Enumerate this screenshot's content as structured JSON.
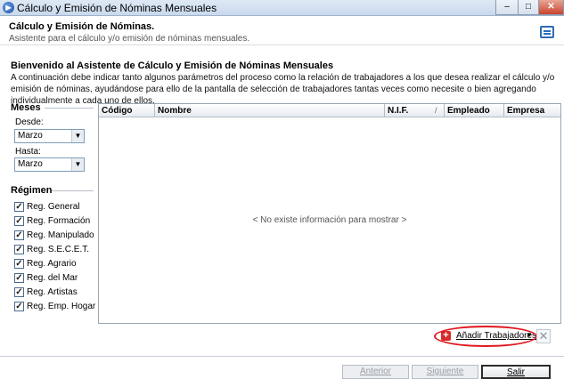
{
  "window": {
    "title": "Cálculo y Emisión de Nóminas Mensuales",
    "controls": {
      "minimize": "–",
      "maximize": "□",
      "close": "✕"
    }
  },
  "header": {
    "title": "Cálculo y Emisión de Nóminas.",
    "subtitle": "Asistente para el cálculo y/o emisión de nóminas mensuales."
  },
  "welcome": {
    "heading": "Bienvenido al Asistente de Cálculo y Emisión de Nóminas Mensuales",
    "text": "A continuación debe indicar tanto algunos parámetros del proceso como la relación de trabajadores a los que desea realizar el cálculo y/o emisión de nóminas, ayudándose para ello de la pantalla de selección de trabajadores tantas veces como necesite o bien agregando individualmente a cada uno de ellos."
  },
  "meses": {
    "label": "Meses",
    "desde": {
      "label": "Desde:",
      "value": "Marzo"
    },
    "hasta": {
      "label": "Hasta:",
      "value": "Marzo"
    }
  },
  "regimen": {
    "label": "Régimen",
    "items": [
      {
        "label": "Reg. General",
        "checked": true
      },
      {
        "label": "Reg. Formación",
        "checked": true
      },
      {
        "label": "Reg. Manipulado",
        "checked": true
      },
      {
        "label": "Reg. S.E.C.E.T.",
        "checked": true
      },
      {
        "label": "Reg. Agrario",
        "checked": true
      },
      {
        "label": "Reg. del Mar",
        "checked": true
      },
      {
        "label": "Reg. Artistas",
        "checked": true
      },
      {
        "label": "Reg. Emp. Hogar",
        "checked": true
      }
    ]
  },
  "grid": {
    "columns": [
      "Código",
      "Nombre",
      "N.I.F.",
      "Empleado",
      "Empresa"
    ],
    "sort_indicator": "/",
    "empty_message": "< No existe información para mostrar >"
  },
  "actions": {
    "add_workers": "Añadir Trabajadores",
    "add_icon": "+",
    "delete_icon": "✕"
  },
  "footer": {
    "anterior": "Anterior",
    "siguiente": "Siguiente",
    "salir": "Salir"
  },
  "colors": {
    "highlight_ellipse": "#e0181f",
    "add_icon": "#d72a2a"
  }
}
